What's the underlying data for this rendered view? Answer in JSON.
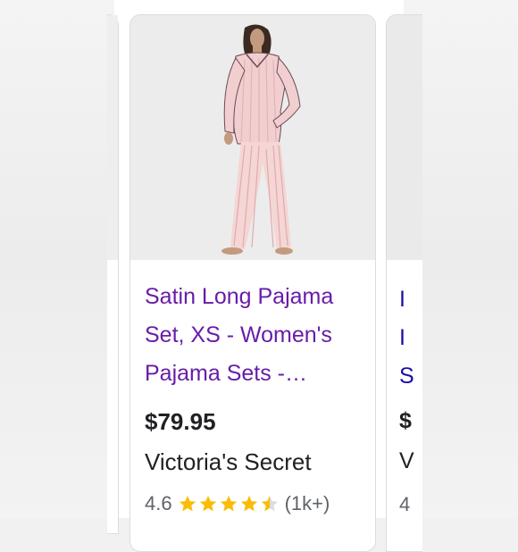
{
  "product": {
    "title": "Satin Long Pajama Set, XS - Women's Pajama Sets - Victoria's Secret",
    "price": "$79.95",
    "store": "Victoria's Secret",
    "rating": 4.6,
    "rating_text": "4.6",
    "review_count": "(1k+)",
    "title_color": "#681da8"
  },
  "right_card_peek": {
    "line1": "I",
    "line2": "I",
    "line3": "S",
    "price_initial": "$",
    "store_initial": "V",
    "rating_initial": "4"
  },
  "icons": {
    "image": "pajama-model-image",
    "stars": "star-icon"
  },
  "colors": {
    "star": "#fbbc04",
    "star_empty": "#dadce0",
    "link": "#1a0dab"
  }
}
